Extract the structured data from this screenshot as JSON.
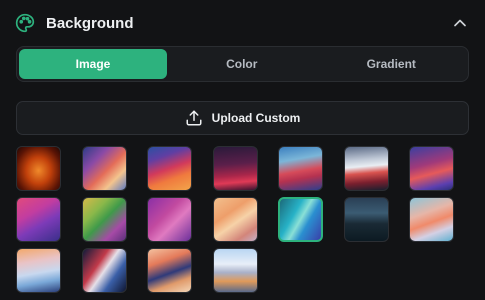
{
  "header": {
    "title": "Background",
    "icon": "palette-icon",
    "collapse_icon": "chevron-up-icon"
  },
  "tabs": [
    {
      "label": "Image",
      "active": true
    },
    {
      "label": "Color",
      "active": false
    },
    {
      "label": "Gradient",
      "active": false
    }
  ],
  "upload": {
    "label": "Upload Custom",
    "icon": "upload-icon"
  },
  "wallpapers": {
    "count": 18,
    "selected_index": 11
  },
  "colors": {
    "accent": "#2db27e",
    "background": "#121315",
    "surface": "#1a1c1f"
  }
}
